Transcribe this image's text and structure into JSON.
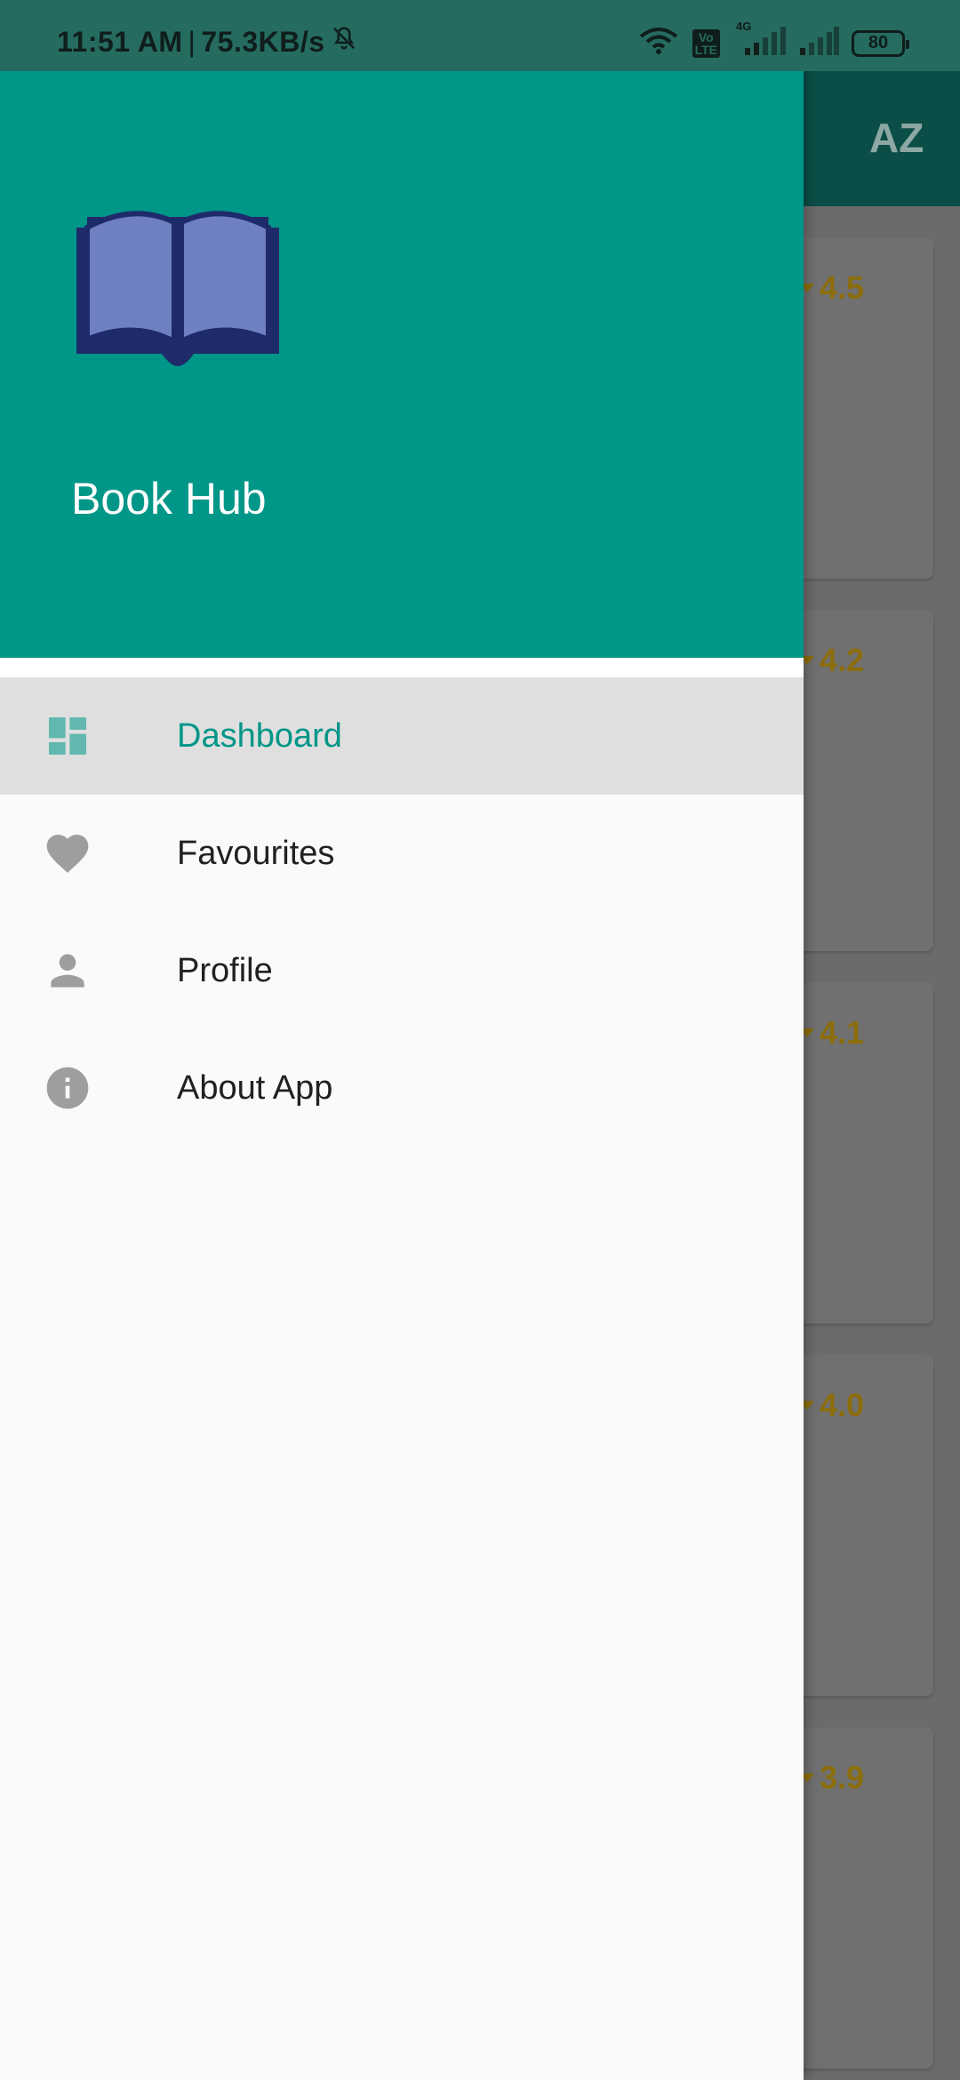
{
  "status_bar": {
    "time": "11:51 AM",
    "separator": "|",
    "network_speed": "75.3KB/s",
    "network_type": "4G",
    "volte_top": "Vo",
    "volte_bottom": "LTE",
    "battery": "80",
    "icons": [
      "mute-icon",
      "wifi-icon",
      "volte-icon",
      "signal-icon",
      "signal-icon",
      "battery-icon"
    ]
  },
  "drawer": {
    "app_name": "Book Hub",
    "logo_icon": "open-book-icon",
    "items": [
      {
        "label": "Dashboard",
        "icon": "dashboard-icon",
        "selected": true
      },
      {
        "label": "Favourites",
        "icon": "heart-icon",
        "selected": false
      },
      {
        "label": "Profile",
        "icon": "person-icon",
        "selected": false
      },
      {
        "label": "About App",
        "icon": "info-icon",
        "selected": false
      }
    ]
  },
  "background": {
    "app_bar_action_icon": "sort-az-icon",
    "sort_label": "AZ",
    "ratings": [
      "4.5",
      "4.2",
      "4.1",
      "4.0",
      "3.9"
    ]
  },
  "colors": {
    "accent": "#009688",
    "selected_bg": "#dfdfdf",
    "rating": "#8c6d0c",
    "logo_dark": "#1f2a6b",
    "logo_light": "#6e7fc2"
  }
}
